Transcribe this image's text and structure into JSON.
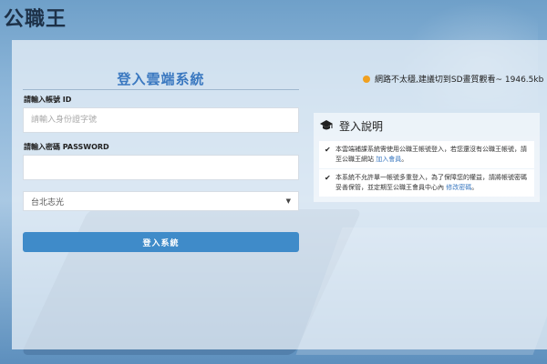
{
  "brand": {
    "logo_text": "公職王"
  },
  "login": {
    "title": "登入雲端系統",
    "id_label": "請輸入帳號 ID",
    "id_placeholder": "請輸入身份證字號",
    "id_value": "",
    "password_label": "請輸入密碼 PASSWORD",
    "password_value": "",
    "location_selected": "台北志光",
    "submit_label": "登入系統"
  },
  "network": {
    "status_color": "#f0a020",
    "message": "網路不太穩,建議切到SD畫質觀看~ 1946.5kb"
  },
  "info": {
    "title": "登入說明",
    "items": [
      {
        "text": "本雲端補課系統需使用公職王帳號登入，若您還沒有公職王帳號，請至公職王網站",
        "link": "加入會員",
        "suffix": "。"
      },
      {
        "text": "本系統不允許單一帳號多重登入，為了保障您的權益，請將帳號密碼妥善保管，並定期至公職王會員中心內",
        "link": "修改密碼",
        "suffix": "。"
      }
    ]
  },
  "colors": {
    "accent": "#3f8bc9",
    "title": "#3a78c0"
  },
  "icons": {
    "graduation": "graduation-cap-icon",
    "check": "check-icon",
    "dropdown": "caret-down-icon"
  }
}
